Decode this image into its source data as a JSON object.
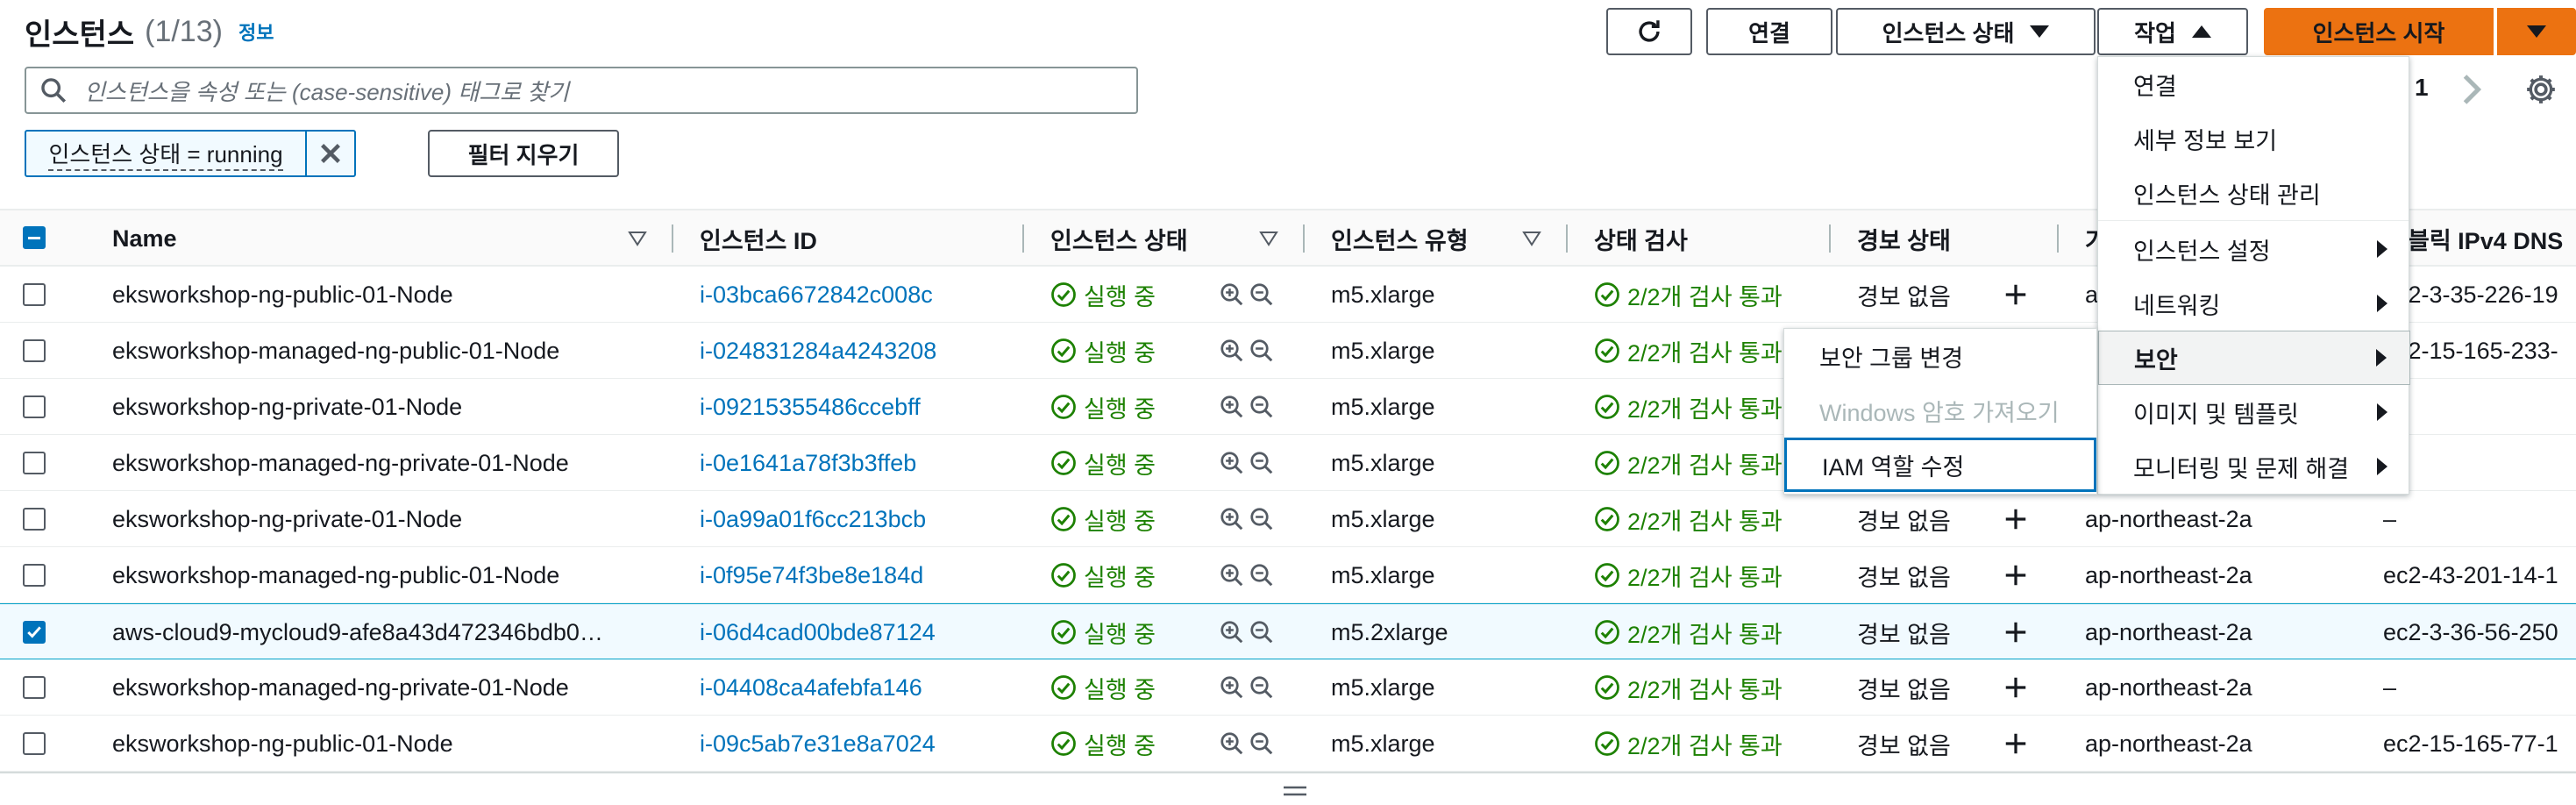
{
  "header": {
    "title": "인스턴스",
    "count": "(1/13)",
    "info": "정보"
  },
  "toolbar": {
    "connect": "연결",
    "instance_state": "인스턴스 상태",
    "actions": "작업",
    "launch": "인스턴스 시작"
  },
  "search": {
    "placeholder": "인스턴스을 속성 또는 (case-sensitive) 태그로 찾기"
  },
  "filter": {
    "token": "인스턴스 상태 = running",
    "clear": "필터 지우기"
  },
  "pagination": {
    "page": "1"
  },
  "columns": [
    "Name",
    "인스턴스 ID",
    "인스턴스 상태",
    "인스턴스 유형",
    "상태 검사",
    "경보 상태",
    "가",
    "블릭 IPv4 DNS"
  ],
  "rows": [
    {
      "name": "eksworkshop-ng-public-01-Node",
      "id": "i-03bca6672842c008c",
      "state": "실행 중",
      "type": "m5.xlarge",
      "check": "2/2개 검사 통과",
      "alarm": "경보 없음",
      "az": "a",
      "dns": "ec2-3-35-226-19",
      "checked": false
    },
    {
      "name": "eksworkshop-managed-ng-public-01-Node",
      "id": "i-024831284a4243208",
      "state": "실행 중",
      "type": "m5.xlarge",
      "check": "2/2개 검사 통과",
      "alarm": "",
      "az": "",
      "dns": "ec2-15-165-233-",
      "checked": false
    },
    {
      "name": "eksworkshop-ng-private-01-Node",
      "id": "i-09215355486ccebff",
      "state": "실행 중",
      "type": "m5.xlarge",
      "check": "2/2개 검사 통과",
      "alarm": "",
      "az": "",
      "dns": "",
      "checked": false
    },
    {
      "name": "eksworkshop-managed-ng-private-01-Node",
      "id": "i-0e1641a78f3b3ffeb",
      "state": "실행 중",
      "type": "m5.xlarge",
      "check": "2/2개 검사 통과",
      "alarm": "",
      "az": "",
      "dns": "",
      "checked": false
    },
    {
      "name": "eksworkshop-ng-private-01-Node",
      "id": "i-0a99a01f6cc213bcb",
      "state": "실행 중",
      "type": "m5.xlarge",
      "check": "2/2개 검사 통과",
      "alarm": "경보 없음",
      "az": "ap-northeast-2a",
      "dns": "–",
      "checked": false
    },
    {
      "name": "eksworkshop-managed-ng-public-01-Node",
      "id": "i-0f95e74f3be8e184d",
      "state": "실행 중",
      "type": "m5.xlarge",
      "check": "2/2개 검사 통과",
      "alarm": "경보 없음",
      "az": "ap-northeast-2a",
      "dns": "ec2-43-201-14-1",
      "checked": false
    },
    {
      "name": "aws-cloud9-mycloud9-afe8a43d472346bdb0…",
      "id": "i-06d4cad00bde87124",
      "state": "실행 중",
      "type": "m5.2xlarge",
      "check": "2/2개 검사 통과",
      "alarm": "경보 없음",
      "az": "ap-northeast-2a",
      "dns": "ec2-3-36-56-250",
      "checked": true
    },
    {
      "name": "eksworkshop-managed-ng-private-01-Node",
      "id": "i-04408ca4afebfa146",
      "state": "실행 중",
      "type": "m5.xlarge",
      "check": "2/2개 검사 통과",
      "alarm": "경보 없음",
      "az": "ap-northeast-2a",
      "dns": "–",
      "checked": false
    },
    {
      "name": "eksworkshop-ng-public-01-Node",
      "id": "i-09c5ab7e31e8a7024",
      "state": "실행 중",
      "type": "m5.xlarge",
      "check": "2/2개 검사 통과",
      "alarm": "경보 없음",
      "az": "ap-northeast-2a",
      "dns": "ec2-15-165-77-1",
      "checked": false
    }
  ],
  "actions_menu": {
    "items": [
      "연결",
      "세부 정보 보기",
      "인스턴스 상태 관리",
      "인스턴스 설정",
      "네트워킹",
      "보안",
      "이미지 및 템플릿",
      "모니터링 및 문제 해결"
    ]
  },
  "security_submenu": {
    "items": [
      "보안 그룹 변경",
      "Windows 암호 가져오기",
      "IAM 역할 수정"
    ]
  },
  "colors": {
    "accent": "#ec7211",
    "link": "#0073bb",
    "success": "#1d8102"
  }
}
